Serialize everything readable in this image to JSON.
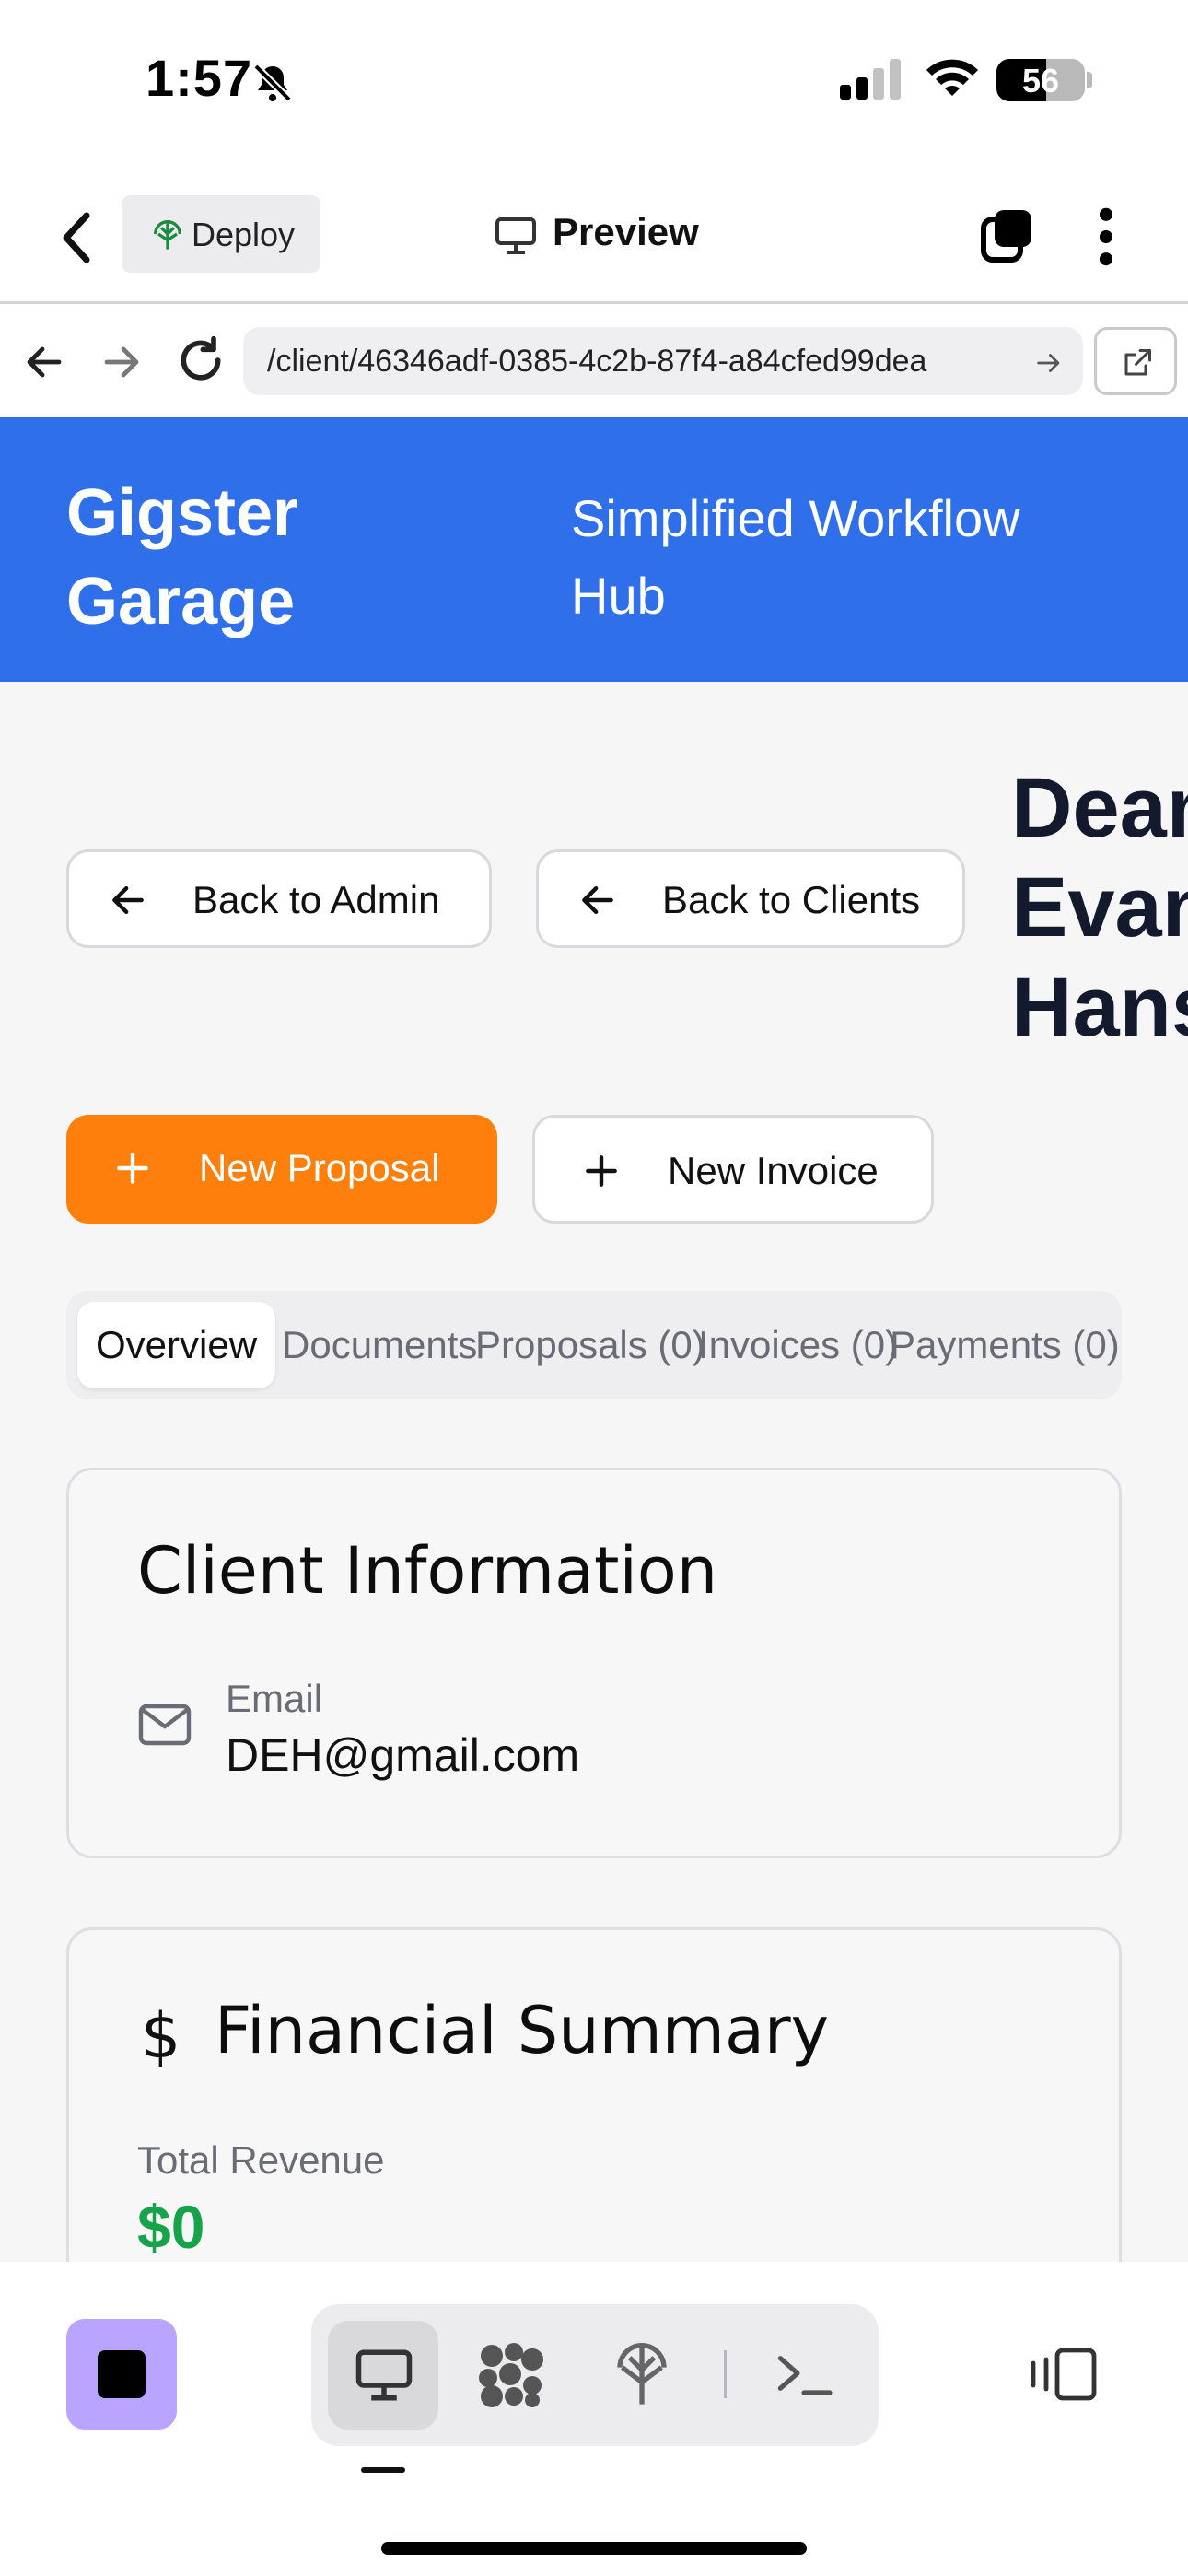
{
  "status_bar": {
    "time": "1:57",
    "battery": "56",
    "icons": [
      "bell-slash-icon",
      "signal-icon",
      "wifi-icon",
      "battery-icon"
    ]
  },
  "app_bar": {
    "deploy_label": "Deploy",
    "preview_label": "Preview",
    "icons": [
      "chevron-left-icon",
      "deploy-icon",
      "monitor-icon",
      "tabs-icon",
      "kebab-icon"
    ]
  },
  "url_bar": {
    "url": "/client/46346adf-0385-4c2b-87f4-a84cfed99dea"
  },
  "site": {
    "brand": "Gigster Garage",
    "tagline": "Simplified Workflow Hub"
  },
  "nav": {
    "back_admin": "Back to Admin",
    "back_clients": "Back to Clients"
  },
  "client": {
    "name": "Dean\nEvans\nHansen"
  },
  "actions": {
    "new_proposal": "New Proposal",
    "new_invoice": "New Invoice"
  },
  "tabs": [
    {
      "label": "Overview",
      "active": true
    },
    {
      "label": "Documents",
      "active": false
    },
    {
      "label": "Proposals (0)",
      "active": false
    },
    {
      "label": "Invoices (0)",
      "active": false
    },
    {
      "label": "Payments (0)",
      "active": false
    }
  ],
  "client_info": {
    "title": "Client Information",
    "email_label": "Email",
    "email_value": "DEH@gmail.com"
  },
  "financial": {
    "title": "Financial Summary",
    "revenue_label": "Total Revenue",
    "revenue_value": "$0"
  },
  "colors": {
    "header_blue": "#2f6fe9",
    "proposal_orange": "#ff7f0c",
    "revenue_green": "#16a34a",
    "stop_purple": "#b9a4ff"
  }
}
